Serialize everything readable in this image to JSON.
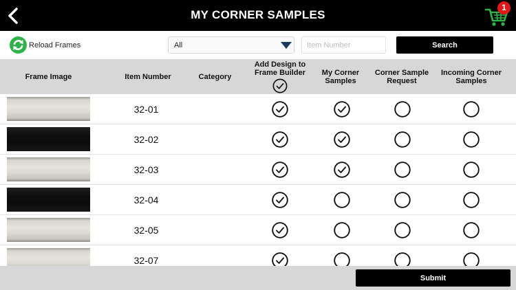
{
  "header": {
    "title": "MY CORNER SAMPLES",
    "back_icon": "chevron-left-icon",
    "cart_icon": "shopping-cart-icon",
    "cart_count": "1",
    "cart_color": "#2fb24a",
    "badge_color": "#e01818"
  },
  "filters": {
    "reload_label": "Reload Frames",
    "reload_icon": "refresh-icon",
    "reload_color": "#2fb24a",
    "category_value": "All",
    "item_placeholder": "Item Number",
    "item_value": "",
    "search_label": "Search"
  },
  "table": {
    "columns": {
      "frame_image": "Frame Image",
      "item_number": "Item Number",
      "category": "Category",
      "add_design": "Add Design to Frame Builder",
      "my_samples": "My Corner Samples",
      "sample_request": "Corner Sample Request",
      "incoming": "Incoming Corner Samples"
    },
    "add_design_select_all": true,
    "rows": [
      {
        "item_number": "32-01",
        "category": "",
        "finish": "silver",
        "add_design": true,
        "my_samples": true,
        "sample_request": false,
        "incoming": false
      },
      {
        "item_number": "32-02",
        "category": "",
        "finish": "black",
        "add_design": true,
        "my_samples": true,
        "sample_request": false,
        "incoming": false
      },
      {
        "item_number": "32-03",
        "category": "",
        "finish": "silver",
        "add_design": true,
        "my_samples": true,
        "sample_request": false,
        "incoming": false
      },
      {
        "item_number": "32-04",
        "category": "",
        "finish": "black",
        "add_design": true,
        "my_samples": false,
        "sample_request": false,
        "incoming": false
      },
      {
        "item_number": "32-05",
        "category": "",
        "finish": "silver",
        "add_design": true,
        "my_samples": false,
        "sample_request": false,
        "incoming": false
      },
      {
        "item_number": "32-07",
        "category": "",
        "finish": "silver",
        "add_design": true,
        "my_samples": false,
        "sample_request": false,
        "incoming": false
      }
    ]
  },
  "footer": {
    "submit_label": "Submit"
  }
}
